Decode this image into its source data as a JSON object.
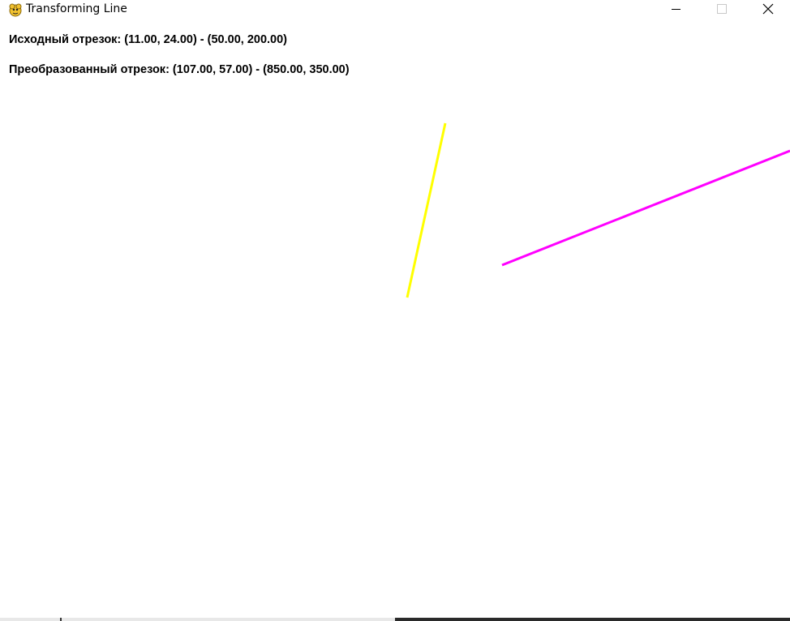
{
  "window": {
    "title": "Transforming Line",
    "app_icon": "pygame-snake-icon",
    "controls": {
      "minimize_icon": "minimize-icon",
      "maximize_icon": "maximize-icon",
      "close_icon": "close-icon"
    }
  },
  "canvas": {
    "background": "#ffffff",
    "original_segment_text": "Исходный отрезок: (11.00, 24.00) - (50.00, 200.00)",
    "transformed_segment_text": "Преобразованный отрезок: (107.00, 57.00) - (850.00, 350.00)",
    "original_segment": {
      "color": "#ffff00"
    },
    "transformed_segment": {
      "color": "#ff00ff"
    }
  }
}
